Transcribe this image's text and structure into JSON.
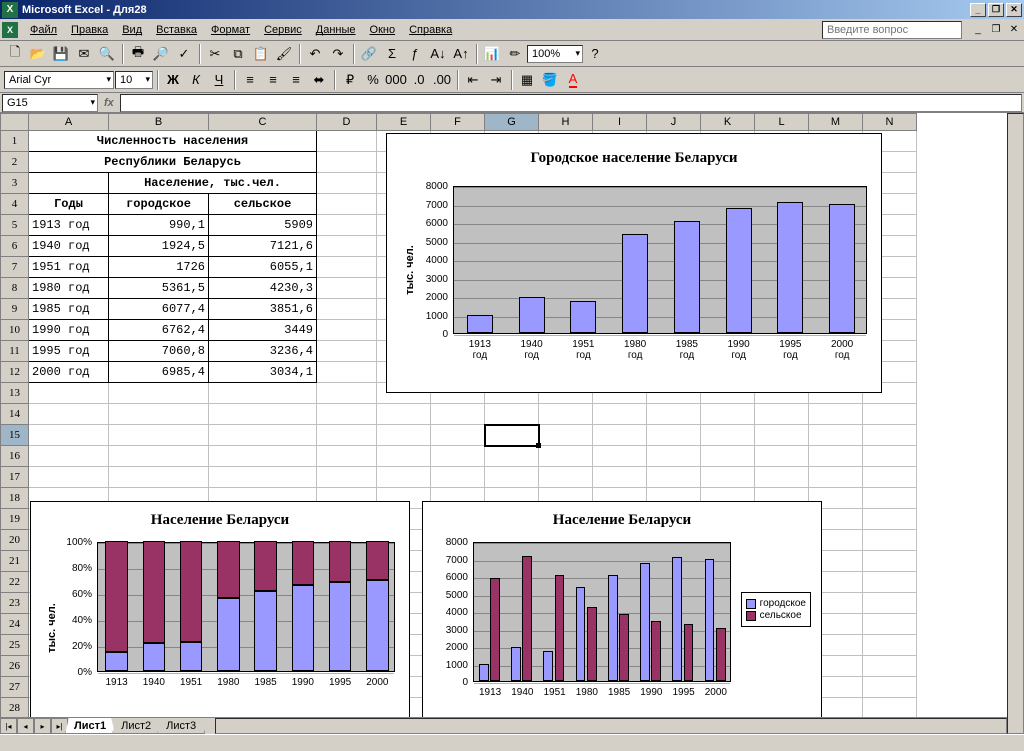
{
  "app": {
    "title": "Microsoft Excel - Для28"
  },
  "menu": {
    "items": [
      "Файл",
      "Правка",
      "Вид",
      "Вставка",
      "Формат",
      "Сервис",
      "Данные",
      "Окно",
      "Справка"
    ],
    "helpbox_placeholder": "Введите вопрос"
  },
  "toolbar": {
    "zoom": "100%"
  },
  "format": {
    "font": "Arial Cyr",
    "size": "10"
  },
  "formula": {
    "cellref": "G15"
  },
  "grid": {
    "cols": [
      "A",
      "B",
      "C",
      "D",
      "E",
      "F",
      "G",
      "H",
      "I",
      "J",
      "K",
      "L",
      "M",
      "N"
    ],
    "rows": 29,
    "title1": "Численность населения",
    "title2": "Республики Беларусь",
    "hdr_pop": "Население, тыс.чел.",
    "hdr_years": "Годы",
    "hdr_urban": "городское",
    "hdr_rural": "сельское",
    "data": [
      {
        "y": "1913 год",
        "u": "990,1",
        "r": "5909"
      },
      {
        "y": "1940 год",
        "u": "1924,5",
        "r": "7121,6"
      },
      {
        "y": "1951 год",
        "u": "1726",
        "r": "6055,1"
      },
      {
        "y": "1980 год",
        "u": "5361,5",
        "r": "4230,3"
      },
      {
        "y": "1985 год",
        "u": "6077,4",
        "r": "3851,6"
      },
      {
        "y": "1990 год",
        "u": "6762,4",
        "r": "3449"
      },
      {
        "y": "1995 год",
        "u": "7060,8",
        "r": "3236,4"
      },
      {
        "y": "2000 год",
        "u": "6985,4",
        "r": "3034,1"
      }
    ]
  },
  "sheets": {
    "tabs": [
      "Лист1",
      "Лист2",
      "Лист3"
    ],
    "active": 0
  },
  "chart_data": [
    {
      "id": "chart1",
      "type": "bar",
      "title": "Городское население Беларуси",
      "ylabel": "тыс. чел.",
      "ylim": [
        0,
        8000
      ],
      "ytick": 1000,
      "categories": [
        "1913 год",
        "1940 год",
        "1951 год",
        "1980 год",
        "1985 год",
        "1990 год",
        "1995 год",
        "2000 год"
      ],
      "values": [
        990.1,
        1924.5,
        1726,
        5361.5,
        6077.4,
        6762.4,
        7060.8,
        6985.4
      ]
    },
    {
      "id": "chart2",
      "type": "stacked-bar-100",
      "title": "Население Беларуси",
      "ylabel": "тыс. чел.",
      "ylim": [
        0,
        100
      ],
      "ytick": 20,
      "yformat": "%",
      "categories": [
        "1913",
        "1940",
        "1951",
        "1980",
        "1985",
        "1990",
        "1995",
        "2000"
      ],
      "series": [
        {
          "name": "городское",
          "values": [
            990.1,
            1924.5,
            1726,
            5361.5,
            6077.4,
            6762.4,
            7060.8,
            6985.4
          ],
          "color": "#9999ff"
        },
        {
          "name": "сельское",
          "values": [
            5909,
            7121.6,
            6055.1,
            4230.3,
            3851.6,
            3449,
            3236.4,
            3034.1
          ],
          "color": "#993366"
        }
      ]
    },
    {
      "id": "chart3",
      "type": "bar-grouped",
      "title": "Население Беларуси",
      "ylim": [
        0,
        8000
      ],
      "ytick": 1000,
      "categories": [
        "1913",
        "1940",
        "1951",
        "1980",
        "1985",
        "1990",
        "1995",
        "2000"
      ],
      "series": [
        {
          "name": "городское",
          "values": [
            990.1,
            1924.5,
            1726,
            5361.5,
            6077.4,
            6762.4,
            7060.8,
            6985.4
          ],
          "color": "#9999ff"
        },
        {
          "name": "сельское",
          "values": [
            5909,
            7121.6,
            6055.1,
            4230.3,
            3851.6,
            3449,
            3236.4,
            3034.1
          ],
          "color": "#993366"
        }
      ],
      "legend": [
        "городское",
        "сельское"
      ]
    }
  ]
}
